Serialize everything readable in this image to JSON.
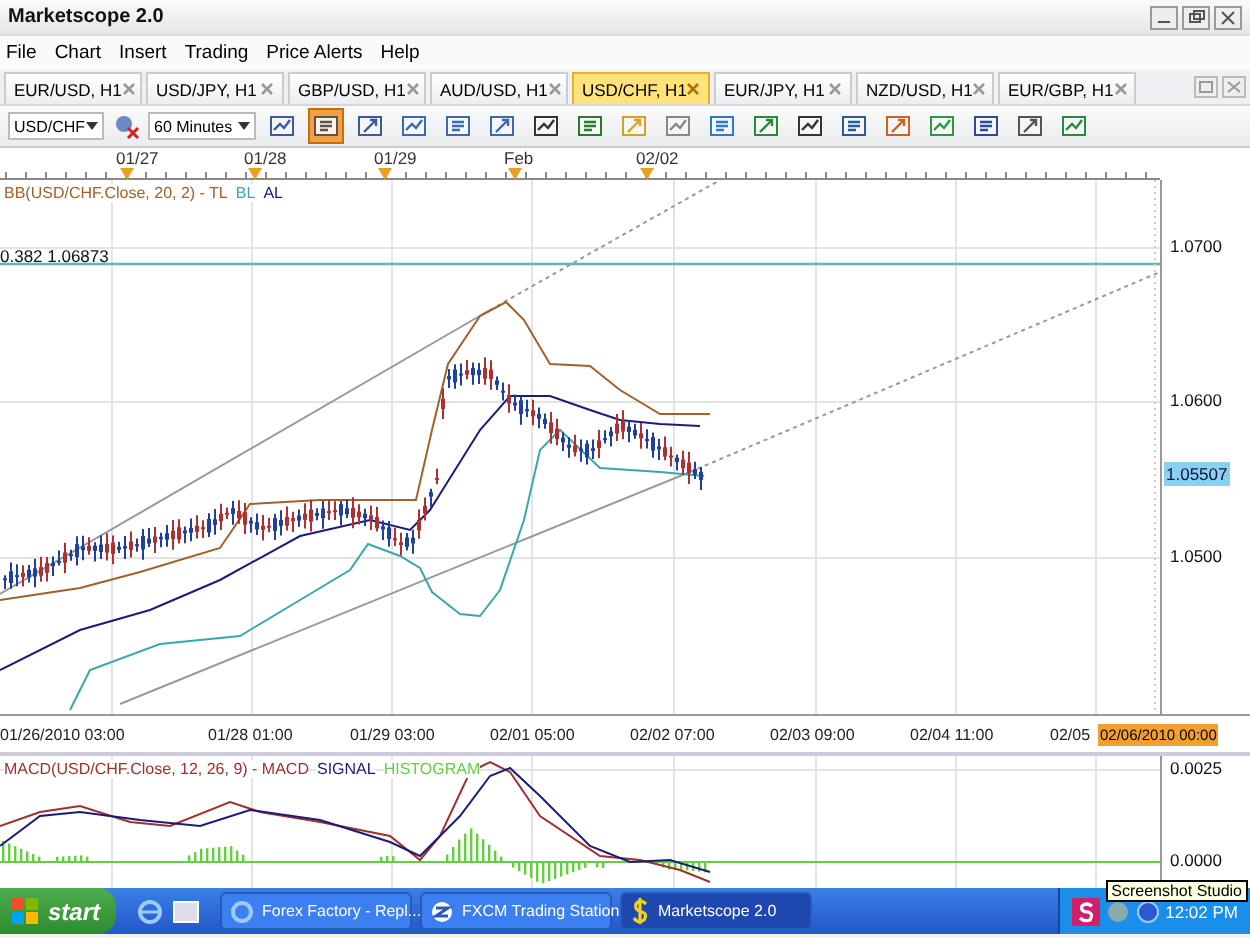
{
  "window": {
    "title": "Marketscope 2.0"
  },
  "menu": [
    "File",
    "Chart",
    "Insert",
    "Trading",
    "Price Alerts",
    "Help"
  ],
  "tabs": [
    {
      "label": "EUR/USD, H1",
      "selected": false
    },
    {
      "label": "USD/JPY, H1",
      "selected": false
    },
    {
      "label": "GBP/USD, H1",
      "selected": false
    },
    {
      "label": "AUD/USD, H1",
      "selected": false
    },
    {
      "label": "USD/CHF, H1",
      "selected": true
    },
    {
      "label": "EUR/JPY, H1",
      "selected": false
    },
    {
      "label": "NZD/USD, H1",
      "selected": false
    },
    {
      "label": "EUR/GBP, H1",
      "selected": false
    }
  ],
  "toolbar": {
    "instrument": "USD/CHF",
    "timeframe": "60 Minutes",
    "tools": [
      {
        "kind": "chart-style",
        "selected": false
      },
      {
        "kind": "properties",
        "selected": true
      },
      {
        "kind": "data-window",
        "selected": false
      },
      {
        "kind": "zoom-in",
        "selected": false
      },
      {
        "kind": "zoom-out",
        "selected": false
      },
      {
        "kind": "cursor",
        "selected": false
      },
      {
        "kind": "magnify",
        "selected": false
      },
      {
        "kind": "level",
        "selected": false
      },
      {
        "kind": "note",
        "selected": false
      },
      {
        "kind": "refresh",
        "selected": false
      },
      {
        "kind": "globe",
        "selected": false
      },
      {
        "kind": "picture",
        "selected": false
      },
      {
        "kind": "text",
        "selected": false
      },
      {
        "kind": "split",
        "selected": false
      },
      {
        "kind": "pencil",
        "selected": false
      },
      {
        "kind": "tree",
        "selected": false
      },
      {
        "kind": "formula",
        "selected": false
      },
      {
        "kind": "eraser",
        "selected": false
      },
      {
        "kind": "network",
        "selected": false
      }
    ]
  },
  "top_axis": [
    "01/27",
    "01/28",
    "01/29",
    "Feb",
    "02/02"
  ],
  "price_chart": {
    "legend": [
      {
        "text": "BB(USD/CHF.Close, 20, 2) - TL",
        "color": "#a0622d"
      },
      {
        "text": "BL",
        "color": "#3aa8a8"
      },
      {
        "text": "AL",
        "color": "#1c1c78"
      }
    ],
    "fib_label": "0.382 1.06873",
    "price_ticks": [
      "1.0700",
      "1.0600",
      "1.0500"
    ],
    "current_price": "1.05507"
  },
  "time_axis": [
    "01/26/2010 03:00",
    "01/28 01:00",
    "01/29 03:00",
    "02/01 05:00",
    "02/02 07:00",
    "02/03 09:00",
    "02/04 11:00",
    "02/05"
  ],
  "cursor_time": "02/06/2010 00:00",
  "macd": {
    "legend": [
      {
        "text": "MACD(USD/CHF.Close, 12, 26, 9) - MACD",
        "color": "#a03030"
      },
      {
        "text": "SIGNAL",
        "color": "#1c1c78"
      },
      {
        "text": "HISTOGRAM",
        "color": "#66cc44"
      }
    ],
    "ticks": [
      "0.0025",
      "0.0000"
    ]
  },
  "taskbar": {
    "start": "start",
    "tasks": [
      {
        "label": "Forex Factory - Repl...",
        "kind": "browser",
        "selected": false
      },
      {
        "label": "FXCM Trading Station",
        "kind": "station",
        "selected": false
      },
      {
        "label": "Marketscope 2.0",
        "kind": "dollar",
        "selected": true
      }
    ],
    "clock": "12:02 PM",
    "tooltip": "Screenshot Studio"
  }
}
